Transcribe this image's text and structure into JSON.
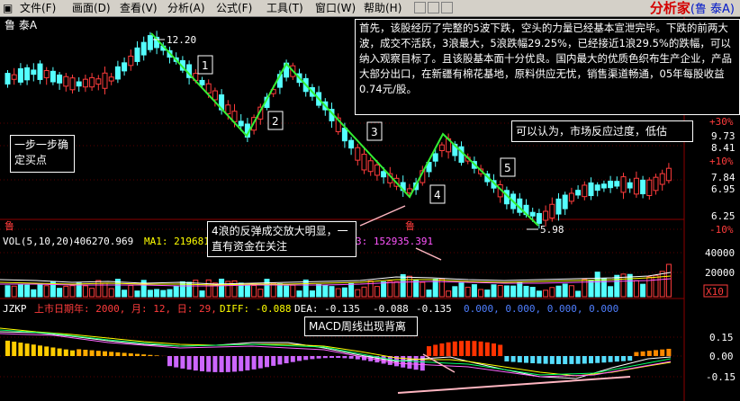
{
  "menu": {
    "items": [
      "文件(F)",
      "画面(D)",
      "查看(V)",
      "分析(A)",
      "公式(F)",
      "工具(T)",
      "窗口(W)",
      "帮助(H)"
    ],
    "brand": "分析家",
    "brand_stock": "(鲁 泰A)"
  },
  "chart": {
    "stock_name": "鲁 泰A",
    "high_label": "12.20",
    "low_label": "5.98",
    "price_ticks": [
      "+30%",
      "9.73",
      "8.41",
      "+10%",
      "7.84",
      "6.95",
      "6.25",
      "-10%"
    ],
    "wave_labels": [
      "1",
      "2",
      "3",
      "4",
      "5"
    ],
    "lu_marks": [
      "鲁",
      "鲁"
    ]
  },
  "annotations": {
    "main_note": "首先，该股经历了完整的5波下跌，空头的力量已经基本宣泄完毕。下跌的前两大波，成交不活跃，3浪最大，5浪跌幅29.25%，已经接近1浪29.5%的跌幅，可以纳入观察目标了。且该股基本面十分优良。国内最大的优质色织布生产企业，产品大部分出口，在新疆有棉花基地，原料供应无忧，销售渠道畅通，05年每股收益0.74元/股。",
    "overreaction_note": "可以认为，市场反应过度，低估",
    "buy_note": "一步一步确定买点",
    "wave4_note": "4浪的反弹成交放大明显，一直有资金在关注",
    "macd_note": "MACD周线出现背离"
  },
  "volume_panel": {
    "title": "VOL(5,10,20)",
    "value": "406270.969",
    "ma1_label": "MA1: 219681",
    "ma3_value": "3: 152935.391",
    "ticks": [
      "40000",
      "20000",
      "X10"
    ]
  },
  "macd_panel": {
    "title": "JZKP",
    "listing_prefix": "上市日期年: 2000, 月: 12, 日: 29,",
    "diff": "DIFF: -0.088",
    "dea": "DEA: -0.135",
    "others": [
      "-0.088",
      "-0.135",
      "0.000, 0.000, 0.000, 0.000"
    ],
    "ticks": [
      "0.15",
      "0.00",
      "-0.15"
    ]
  },
  "colors": {
    "up_candle": "#ff3c3c",
    "down_candle": "#54ffff",
    "wave_line": "#33ee33",
    "grid": "#8b0000"
  }
}
